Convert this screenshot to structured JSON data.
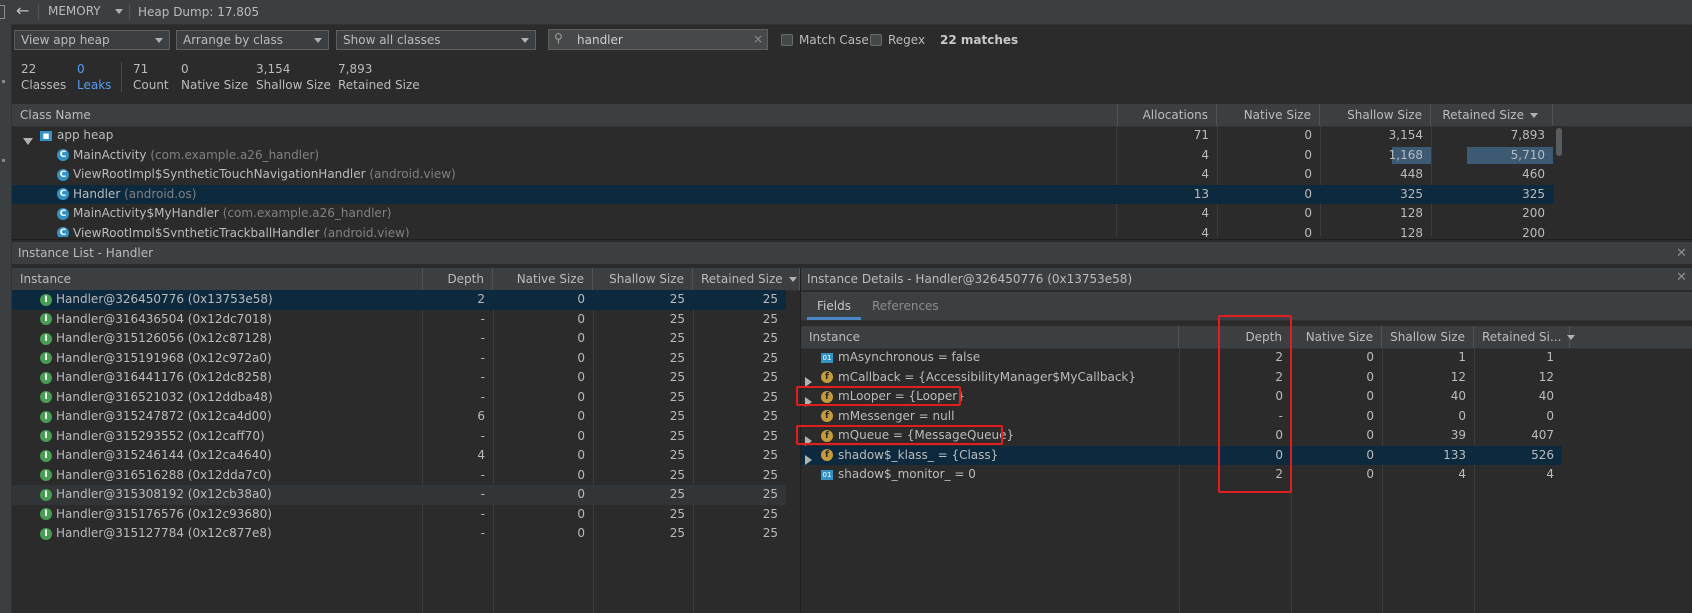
{
  "toolbar": {
    "back_icon": "arrow-left-icon",
    "profiler_label": "MEMORY",
    "heap_dump_label": "Heap Dump: 17.805"
  },
  "filters": {
    "heap_select": "View app heap",
    "arrange_select": "Arrange by class",
    "classes_select": "Show all classes",
    "search_value": "handler",
    "match_case_label": "Match Case",
    "regex_label": "Regex",
    "matches_label": "22 matches"
  },
  "summary": {
    "classes_value": "22",
    "classes_label": "Classes",
    "leaks_value": "0",
    "leaks_label": "Leaks",
    "count_value": "71",
    "count_label": "Count",
    "native_value": "0",
    "native_label": "Native Size",
    "shallow_value": "3,154",
    "shallow_label": "Shallow Size",
    "retained_value": "7,893",
    "retained_label": "Retained Size"
  },
  "class_table": {
    "headers": [
      "Class Name",
      "Allocations",
      "Native Size",
      "Shallow Size",
      "Retained Size"
    ],
    "root": {
      "name": "app heap",
      "allocations": "71",
      "native": "0",
      "shallow": "3,154",
      "retained": "7,893"
    },
    "rows": [
      {
        "name": "MainActivity",
        "pkg": "(com.example.a26_handler)",
        "allocations": "4",
        "native": "0",
        "shallow": "1,168",
        "retained": "5,710"
      },
      {
        "name": "ViewRootImpl$SyntheticTouchNavigationHandler",
        "pkg": "(android.view)",
        "allocations": "4",
        "native": "0",
        "shallow": "448",
        "retained": "460"
      },
      {
        "name": "Handler",
        "pkg": "(android.os)",
        "allocations": "13",
        "native": "0",
        "shallow": "325",
        "retained": "325"
      },
      {
        "name": "MainActivity$MyHandler",
        "pkg": "(com.example.a26_handler)",
        "allocations": "4",
        "native": "0",
        "shallow": "128",
        "retained": "200"
      },
      {
        "name": "ViewRootImpl$SyntheticTrackballHandler",
        "pkg": "(android.view)",
        "allocations": "4",
        "native": "0",
        "shallow": "128",
        "retained": "200"
      }
    ]
  },
  "instance_list": {
    "title": "Instance List - Handler",
    "headers": [
      "Instance",
      "Depth",
      "Native Size",
      "Shallow Size",
      "Retained Size"
    ],
    "rows": [
      {
        "name": "Handler@326450776 (0x13753e58)",
        "depth": "2",
        "native": "0",
        "shallow": "25",
        "retained": "25"
      },
      {
        "name": "Handler@316436504 (0x12dc7018)",
        "depth": "-",
        "native": "0",
        "shallow": "25",
        "retained": "25"
      },
      {
        "name": "Handler@315126056 (0x12c87128)",
        "depth": "-",
        "native": "0",
        "shallow": "25",
        "retained": "25"
      },
      {
        "name": "Handler@315191968 (0x12c972a0)",
        "depth": "-",
        "native": "0",
        "shallow": "25",
        "retained": "25"
      },
      {
        "name": "Handler@316441176 (0x12dc8258)",
        "depth": "-",
        "native": "0",
        "shallow": "25",
        "retained": "25"
      },
      {
        "name": "Handler@316521032 (0x12ddba48)",
        "depth": "-",
        "native": "0",
        "shallow": "25",
        "retained": "25"
      },
      {
        "name": "Handler@315247872 (0x12ca4d00)",
        "depth": "6",
        "native": "0",
        "shallow": "25",
        "retained": "25"
      },
      {
        "name": "Handler@315293552 (0x12caff70)",
        "depth": "-",
        "native": "0",
        "shallow": "25",
        "retained": "25"
      },
      {
        "name": "Handler@315246144 (0x12ca4640)",
        "depth": "4",
        "native": "0",
        "shallow": "25",
        "retained": "25"
      },
      {
        "name": "Handler@316516288 (0x12dda7c0)",
        "depth": "-",
        "native": "0",
        "shallow": "25",
        "retained": "25"
      },
      {
        "name": "Handler@315308192 (0x12cb38a0)",
        "depth": "-",
        "native": "0",
        "shallow": "25",
        "retained": "25"
      },
      {
        "name": "Handler@315176576 (0x12c93680)",
        "depth": "-",
        "native": "0",
        "shallow": "25",
        "retained": "25"
      },
      {
        "name": "Handler@315127784 (0x12c877e8)",
        "depth": "-",
        "native": "0",
        "shallow": "25",
        "retained": "25"
      }
    ]
  },
  "details": {
    "title": "Instance Details - Handler@326450776 (0x13753e58)",
    "tab_fields": "Fields",
    "tab_references": "References",
    "headers": [
      "Instance",
      "Depth",
      "Native Size",
      "Shallow Size",
      "Retained Si..."
    ],
    "rows": [
      {
        "kind": "prim",
        "icon_text": "01",
        "expandable": false,
        "name": "mAsynchronous = false",
        "depth": "2",
        "native": "0",
        "shallow": "1",
        "retained": "1"
      },
      {
        "kind": "field",
        "icon_text": "f",
        "expandable": true,
        "name": "mCallback = {AccessibilityManager$MyCallback}",
        "depth": "2",
        "native": "0",
        "shallow": "12",
        "retained": "12"
      },
      {
        "kind": "field",
        "icon_text": "f",
        "expandable": true,
        "name": "mLooper = {Looper}",
        "depth": "0",
        "native": "0",
        "shallow": "40",
        "retained": "40"
      },
      {
        "kind": "field",
        "icon_text": "f",
        "expandable": false,
        "name": "mMessenger = null",
        "depth": "-",
        "native": "0",
        "shallow": "0",
        "retained": "0"
      },
      {
        "kind": "field",
        "icon_text": "f",
        "expandable": true,
        "name": "mQueue = {MessageQueue}",
        "depth": "0",
        "native": "0",
        "shallow": "39",
        "retained": "407"
      },
      {
        "kind": "field",
        "icon_text": "f",
        "expandable": true,
        "name": "shadow$_klass_ = {Class}",
        "depth": "0",
        "native": "0",
        "shallow": "133",
        "retained": "526"
      },
      {
        "kind": "prim",
        "icon_text": "01",
        "expandable": false,
        "name": "shadow$_monitor_ = 0",
        "depth": "2",
        "native": "0",
        "shallow": "4",
        "retained": "4"
      }
    ]
  },
  "colors": {
    "background": "#2b2b2b",
    "selected_row": "#0d293e",
    "link": "#589df6",
    "highlight_box": "#e01e1e"
  }
}
